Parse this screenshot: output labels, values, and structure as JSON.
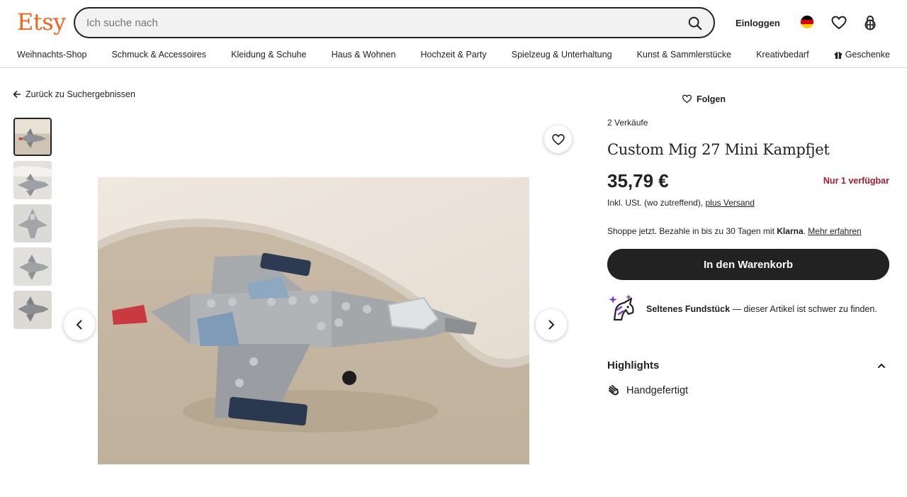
{
  "header": {
    "logo": "Etsy",
    "search_placeholder": "Ich suche nach",
    "login_label": "Einloggen",
    "icons": [
      "search-icon",
      "germany-flag-icon",
      "heart-icon",
      "basket-icon"
    ]
  },
  "nav": [
    "Weihnachts-Shop",
    "Schmuck & Accessoires",
    "Kleidung & Schuhe",
    "Haus & Wohnen",
    "Hochzeit & Party",
    "Spielzeug & Unterhaltung",
    "Kunst & Sammlerstücke",
    "Kreativbedarf",
    "Geschenke"
  ],
  "gallery": {
    "back_label": "Zurück zu Suchergebnissen",
    "thumbnail_count": 5,
    "active_thumbnail": 1
  },
  "shop": {
    "follow_label": "Folgen"
  },
  "product": {
    "sales": "2 Verkäufe",
    "title": "Custom Mig 27 Mini Kampfjet",
    "price": "35,79 €",
    "stock": "Nur 1 verfügbar",
    "tax_text": "Inkl. USt. (wo zutreffend), ",
    "shipping_link": "plus Versand",
    "klarna_text": "Shoppe jetzt. Bezahle in bis zu 30 Tagen mit ",
    "klarna_brand": "Klarna",
    "klarna_link": "Mehr erfahren",
    "cart_button": "In den Warenkorb",
    "rare_bold": "Seltenes Fundstück",
    "rare_rest": " — dieser Artikel ist schwer zu finden."
  },
  "highlights": {
    "title": "Highlights",
    "items": [
      "Handgefertigt"
    ]
  },
  "colors": {
    "brand": "#f1641e",
    "stock_red": "#a61a2e",
    "button_dark": "#222222"
  }
}
